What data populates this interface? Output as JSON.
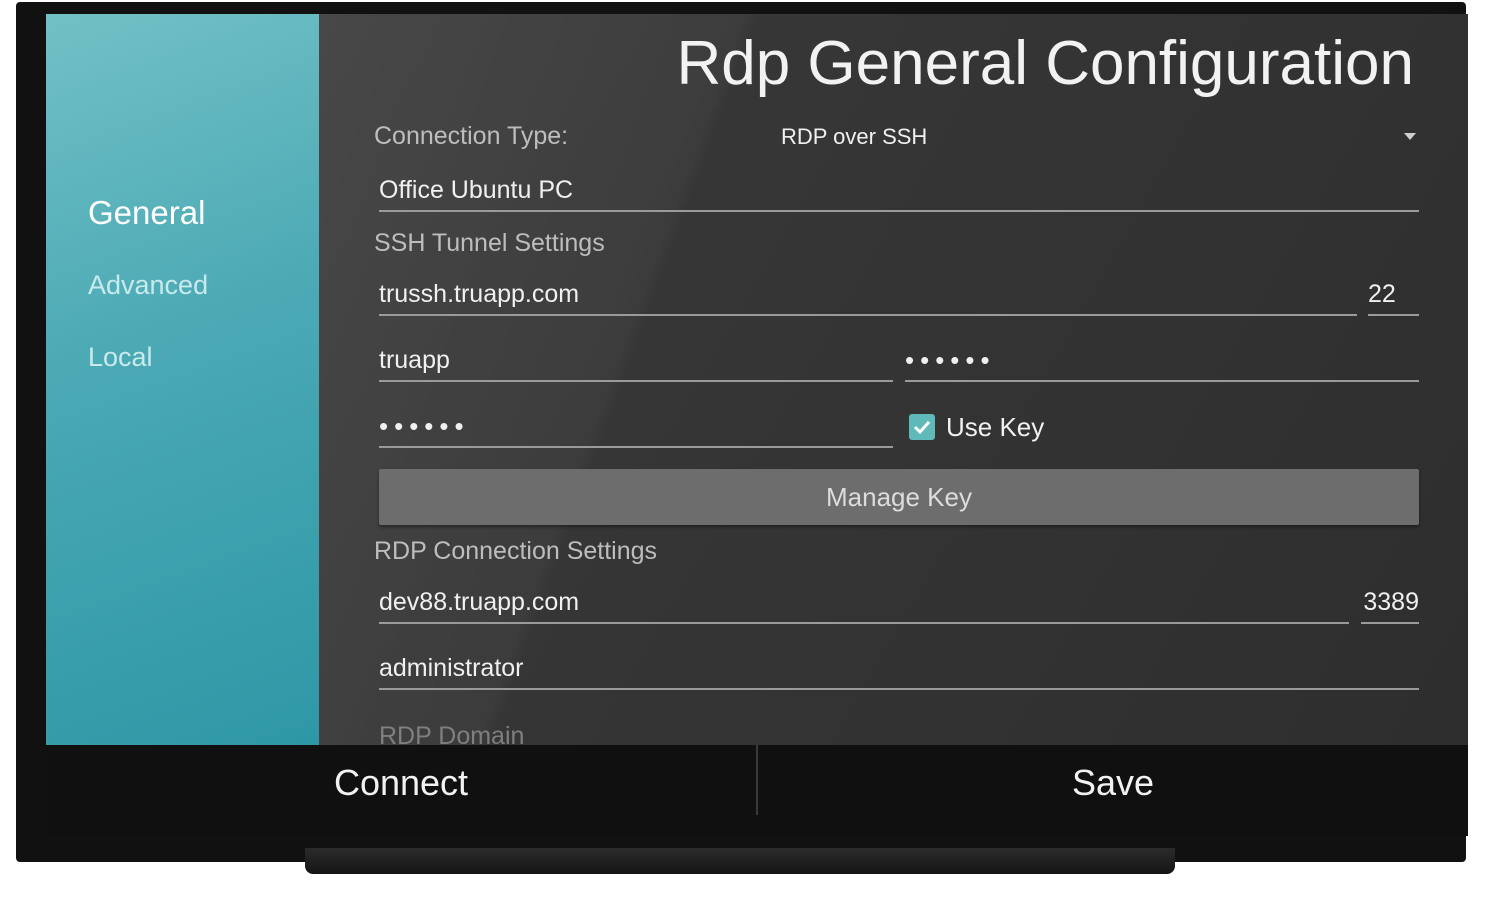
{
  "screen": {
    "title": "Rdp General Configuration"
  },
  "sidebar": {
    "items": [
      {
        "label": "General",
        "active": true
      },
      {
        "label": "Advanced",
        "active": false
      },
      {
        "label": "Local",
        "active": false
      }
    ]
  },
  "form": {
    "connection_type_label": "Connection Type:",
    "connection_type_value": "RDP over SSH",
    "connection_name": "Office Ubuntu PC",
    "ssh_section_label": "SSH Tunnel Settings",
    "ssh_host": "trussh.truapp.com",
    "ssh_port": "22",
    "ssh_user": "truapp",
    "ssh_password": "••••••",
    "ssh_passphrase": "••••••",
    "use_key_label": "Use Key",
    "use_key_checked": true,
    "manage_key_label": "Manage Key",
    "rdp_section_label": "RDP Connection Settings",
    "rdp_host": "dev88.truapp.com",
    "rdp_port": "3389",
    "rdp_user": "administrator",
    "rdp_domain_placeholder": "RDP Domain"
  },
  "actions": {
    "connect_label": "Connect",
    "save_label": "Save"
  },
  "colors": {
    "sidebar_accent": "#4aa9b4",
    "checkbox_accent": "#5fb9b8"
  }
}
